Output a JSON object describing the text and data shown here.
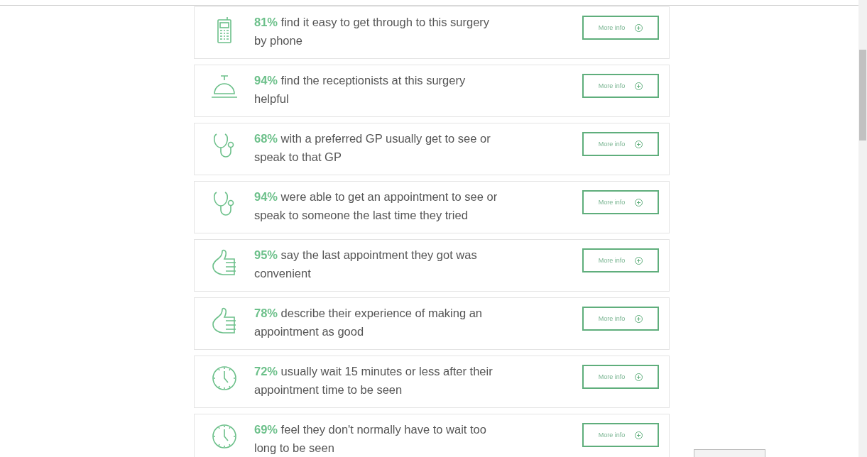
{
  "results": [
    {
      "kind": "phone",
      "text": "**81%** find it easy to get through to this surgery by phone",
      "button": "More info"
    },
    {
      "kind": "bell",
      "text": "**94%** find the receptionists at this surgery helpful",
      "button": "More info"
    },
    {
      "kind": "stethoscope",
      "text": "**68%** with a preferred GP usually get to see or speak to that GP",
      "button": "More info"
    },
    {
      "kind": "stethoscope",
      "text": "**94%** were able to get an appointment to see or speak to someone the last time they tried",
      "button": "More info"
    },
    {
      "kind": "thumb",
      "text": "**95%** say the last appointment they got was convenient",
      "button": "More info"
    },
    {
      "kind": "thumb",
      "text": "**78%** describe their experience of making an appointment as good",
      "button": "More info"
    },
    {
      "kind": "clock",
      "text": "**72%** usually wait 15 minutes or less after their appointment time to be seen",
      "button": "More info"
    },
    {
      "kind": "clock",
      "text": "**69%** feel they don't normally have to wait too long to be seen",
      "button": "More info"
    }
  ]
}
